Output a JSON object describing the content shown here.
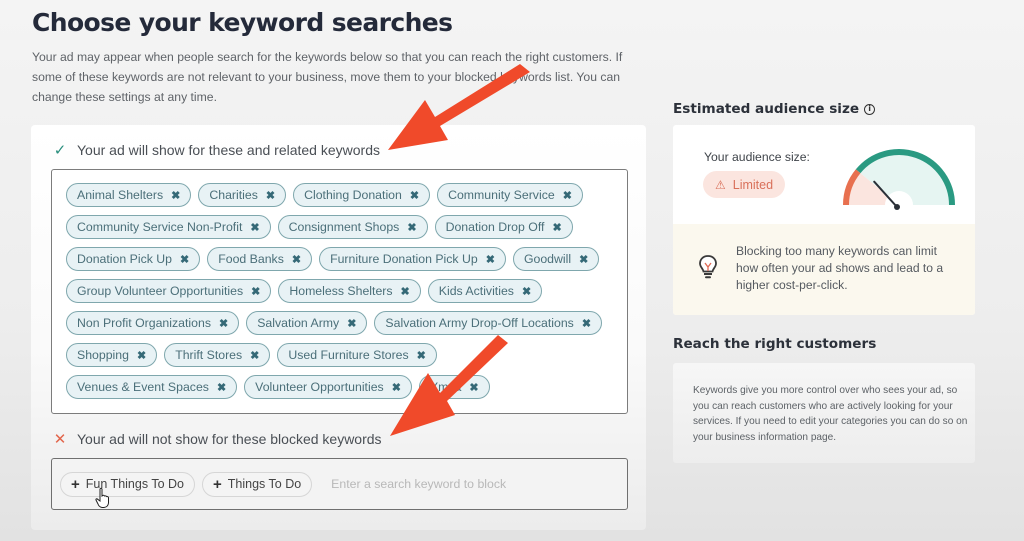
{
  "page": {
    "title": "Choose your keyword searches",
    "intro": "Your ad may appear when people search for the keywords below so that you can reach the right customers. If some of these keywords are not relevant to your business, move them to your blocked keywords list. You can change these settings at any time."
  },
  "allowed": {
    "header": "Your ad will show for these and related keywords",
    "icon": "check-icon",
    "keywords": [
      "Animal Shelters",
      "Charities",
      "Clothing Donation",
      "Community Service",
      "Community Service Non-Profit",
      "Consignment Shops",
      "Donation Drop Off",
      "Donation Pick Up",
      "Food Banks",
      "Furniture Donation Pick Up",
      "Goodwill",
      "Group Volunteer Opportunities",
      "Homeless Shelters",
      "Kids Activities",
      "Non Profit Organizations",
      "Salvation Army",
      "Salvation Army Drop-Off Locations",
      "Shopping",
      "Thrift Stores",
      "Used Furniture Stores",
      "Venues & Event Spaces",
      "Volunteer Opportunities",
      "Ymca"
    ],
    "remove_glyph": "✖"
  },
  "blocked": {
    "header": "Your ad will not show for these blocked keywords",
    "icon": "x-icon",
    "suggestions": [
      "Fun Things To Do",
      "Things To Do"
    ],
    "input_value": "",
    "input_placeholder": "Enter a search keyword to block"
  },
  "audience": {
    "title": "Estimated audience size",
    "label": "Your audience size:",
    "status": "Limited",
    "gauge_level": 0.22,
    "colors": {
      "limited": "#e8704f",
      "good": "#2a9a82",
      "limited_bg": "#fbe5df",
      "good_bg": "#e6f5f2"
    },
    "tip": "Blocking too many keywords can limit how often your ad shows and lead to a higher cost-per-click."
  },
  "reach": {
    "title": "Reach the right customers",
    "text": "Keywords give you more control over who sees your ad, so you can reach customers who are actively looking for your services. If you need to edit your categories you can do so on your business information page."
  },
  "annotations": {
    "arrow_color": "#f04a2a"
  }
}
